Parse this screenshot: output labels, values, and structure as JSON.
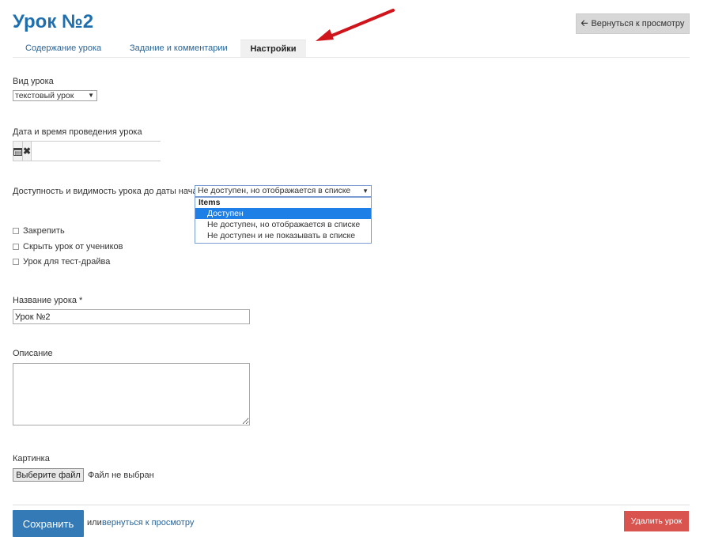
{
  "header": {
    "title": "Урок №2",
    "back_button": "Вернуться к просмотру"
  },
  "tabs": [
    {
      "label": "Содержание урока"
    },
    {
      "label": "Задание и комментарии"
    },
    {
      "label": "Настройки",
      "active": true
    }
  ],
  "form": {
    "lesson_type": {
      "label": "Вид урока",
      "value": "текстовый урок"
    },
    "datetime": {
      "label": "Дата и время проведения урока",
      "value": ""
    },
    "access": {
      "label": "Доступность и видимость урока до даты начала",
      "value": "Не доступен, но отображается в списке",
      "dropdown": {
        "group": "Items",
        "options": [
          {
            "label": "Доступен",
            "highlighted": true
          },
          {
            "label": "Не доступен, но отображается в списке"
          },
          {
            "label": "Не доступен и не показывать в списке"
          }
        ]
      }
    },
    "checkboxes": [
      {
        "label": "Закрепить",
        "checked": false
      },
      {
        "label": "Скрыть урок от учеников",
        "checked": false
      },
      {
        "label": "Урок для тест-драйва",
        "checked": false
      }
    ],
    "name": {
      "label": "Название урока *",
      "value": "Урок №2"
    },
    "description": {
      "label": "Описание",
      "value": ""
    },
    "image": {
      "label": "Картинка",
      "button": "Выберите файл",
      "status": "Файл не выбран"
    }
  },
  "footer": {
    "save_button": "Сохранить",
    "or_text": "или",
    "back_link": "вернуться к просмотру",
    "delete_button": "Удалить урок"
  },
  "colors": {
    "title": "#1f6fae",
    "primary": "#337ab7",
    "danger": "#d9534f",
    "annotation_arrow": "#d0141b"
  },
  "icons": {
    "back": "arrow-left-icon",
    "calendar": "calendar-icon",
    "clear": "close-icon"
  }
}
